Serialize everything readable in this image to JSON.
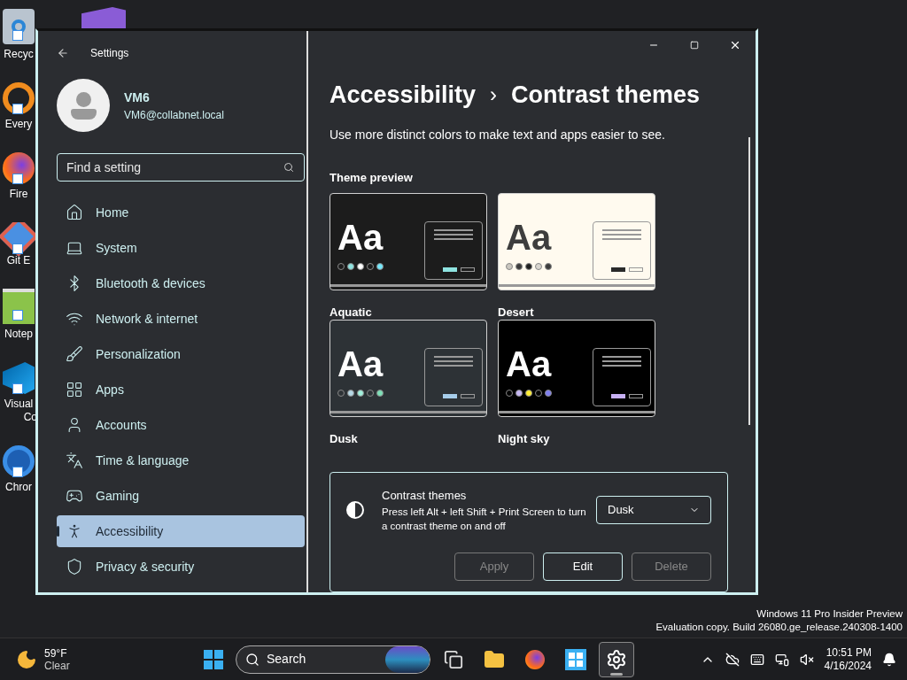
{
  "desktop": {
    "icons": [
      {
        "kind": "bin",
        "label": "Recyc"
      },
      {
        "kind": "ide",
        "label": "Every"
      },
      {
        "kind": "browser",
        "label": "Fire"
      },
      {
        "kind": "diamond",
        "label": "Git E"
      },
      {
        "kind": "notepad",
        "label": "Notep"
      },
      {
        "kind": "code",
        "label": "Visual",
        "label_2": "Co"
      },
      {
        "kind": "ring",
        "label": "Chror"
      }
    ]
  },
  "window": {
    "title": "Settings",
    "user": {
      "name": "VM6",
      "email": "VM6@collabnet.local"
    },
    "search": {
      "placeholder": "Find a setting"
    },
    "nav": [
      {
        "label": "Home",
        "selected": false
      },
      {
        "label": "System",
        "selected": false
      },
      {
        "label": "Bluetooth & devices",
        "selected": false
      },
      {
        "label": "Network & internet",
        "selected": false
      },
      {
        "label": "Personalization",
        "selected": false
      },
      {
        "label": "Apps",
        "selected": false
      },
      {
        "label": "Accounts",
        "selected": false
      },
      {
        "label": "Time & language",
        "selected": false
      },
      {
        "label": "Gaming",
        "selected": false
      },
      {
        "label": "Accessibility",
        "selected": true
      },
      {
        "label": "Privacy & security",
        "selected": false
      }
    ],
    "breadcrumb": [
      "Accessibility",
      "Contrast themes"
    ],
    "breadcrumb_separator": "›",
    "description": "Use more distinct colors to make text and apps easier to see.",
    "section_title": "Theme preview",
    "themes": [
      {
        "name": "Aquatic",
        "background": {
          "color": "#1c1c1c"
        },
        "sample": {
          "text": "Aa",
          "color": "#ffffff"
        },
        "dots": [
          {
            "color": "#1c1c1c"
          },
          {
            "color": "#8ee3e0"
          },
          {
            "color": "#ffffff"
          },
          {
            "color": "#1c1c1c"
          },
          {
            "color": "#75e9fc"
          }
        ],
        "accent": {
          "color": "#8ee3e0"
        }
      },
      {
        "name": "Desert",
        "background": {
          "color": "#fffaef"
        },
        "sample": {
          "text": "Aa",
          "color": "#3d3d3d"
        },
        "dots": [
          {
            "color": "#c9c6bf"
          },
          {
            "color": "#3d3d3d"
          },
          {
            "color": "#202020"
          },
          {
            "color": "#d8d5cf"
          },
          {
            "color": "#3d3d3d"
          }
        ],
        "accent": {
          "color": "#2a2a2a"
        }
      },
      {
        "name": "Dusk",
        "background": {
          "color": "#2d3236"
        },
        "sample": {
          "text": "Aa",
          "color": "#ffffff"
        },
        "dots": [
          {
            "color": "#2d3236"
          },
          {
            "color": "#b6d8e5"
          },
          {
            "color": "#a1f0dc"
          },
          {
            "color": "#2d3236"
          },
          {
            "color": "#7de0b8"
          }
        ],
        "accent": {
          "color": "#a6cdea"
        }
      },
      {
        "name": "Night sky",
        "background": {
          "color": "#000000"
        },
        "sample": {
          "text": "Aa",
          "color": "#ffffff"
        },
        "dots": [
          {
            "color": "#000000"
          },
          {
            "color": "#c7b8f5"
          },
          {
            "color": "#ffee32"
          },
          {
            "color": "#000000"
          },
          {
            "color": "#8080f0"
          }
        ],
        "accent": {
          "color": "#c7b0f5"
        }
      }
    ],
    "contrast_card": {
      "title": "Contrast themes",
      "description": "Press left Alt + left Shift + Print Screen to turn a contrast theme on and off",
      "dropdown": "Dusk",
      "buttons": [
        {
          "label": "Apply",
          "disabled": true
        },
        {
          "label": "Edit",
          "disabled": false
        },
        {
          "label": "Delete",
          "disabled": true
        }
      ]
    }
  },
  "watermark": [
    "Windows 11 Pro Insider Preview",
    "Evaluation copy. Build 26080.ge_release.240308-1400"
  ],
  "taskbar": {
    "weather": {
      "temperature": "59°F",
      "condition": "Clear"
    },
    "search": "Search",
    "apps": [
      {
        "kind": "taskview",
        "selected": false
      },
      {
        "kind": "folder",
        "selected": false
      },
      {
        "kind": "browser",
        "selected": false
      },
      {
        "kind": "store",
        "selected": false
      },
      {
        "kind": "settings",
        "selected": true
      }
    ],
    "time": "10:51 PM",
    "date": "4/16/2024"
  }
}
